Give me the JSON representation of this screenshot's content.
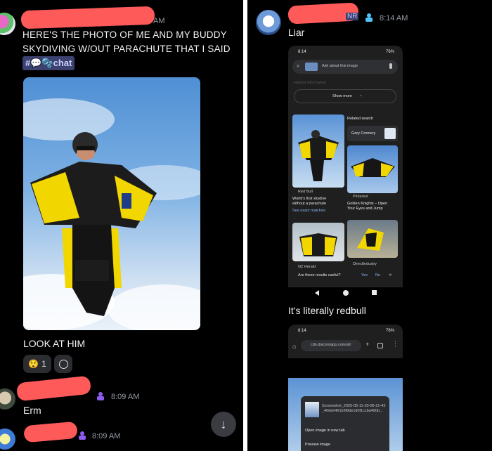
{
  "left": {
    "top_message": {
      "time_fragment": "AM",
      "text_line1": "HERE'S THE PHOTO OF ME AND MY BUDDY",
      "text_line2": "SKYDIVING W/OUT PARACHUTE THAT I SAID AT",
      "channel_prefix": "#",
      "channel_name": "chat",
      "caption": "LOOK AT HIM",
      "reactions": [
        {
          "emoji": "😲",
          "count": "1"
        }
      ]
    },
    "second_message": {
      "time": "8:09 AM",
      "text": "Erm"
    },
    "third_message": {
      "time": "8:09 AM"
    }
  },
  "right": {
    "top_message": {
      "name_fragment": "NR",
      "time": "8:14 AM",
      "text": "Liar"
    },
    "phone1": {
      "clock": "8:14",
      "battery": "76%",
      "search_placeholder": "Ask about this image",
      "faded_text": "Helpful information",
      "show_more": "Show more",
      "related_label": "Related search",
      "related_chip": "Gary Connery",
      "result1": {
        "source": "Red Bull",
        "title_line1": "World's first skydive",
        "title_line2": "without a parachute",
        "link": "See exact matches"
      },
      "result2": {
        "source": "Pinterest",
        "title_line1": "Golden Knights – Open",
        "title_line2": "Your Eyes and Jump"
      },
      "result3": {
        "source": "NZ Herald"
      },
      "result4": {
        "source": "DirectIndustry"
      },
      "feedback_q": "Are these results useful?",
      "yes": "Yes",
      "no": "No"
    },
    "middle_message": {
      "text": "It's literally redbull"
    },
    "phone2": {
      "clock": "8:14",
      "battery": "76%",
      "url": "cdn.discordapp.com/att",
      "file_line1": "Screenshot_2025-05-11-20-06-21-43",
      "file_line2": "_40deb401b9f9de1d0f1ccba490b...",
      "menu_item1": "Open image in new tab",
      "menu_item2": "Preview image"
    }
  },
  "colors": {
    "redaction": "#ff5a5a",
    "background": "#000000",
    "channel_chip": "#3c4270",
    "link_blue": "#8ab4f8",
    "role_purple": "#8e5cf0",
    "role_cyan": "#4fc3f7"
  }
}
